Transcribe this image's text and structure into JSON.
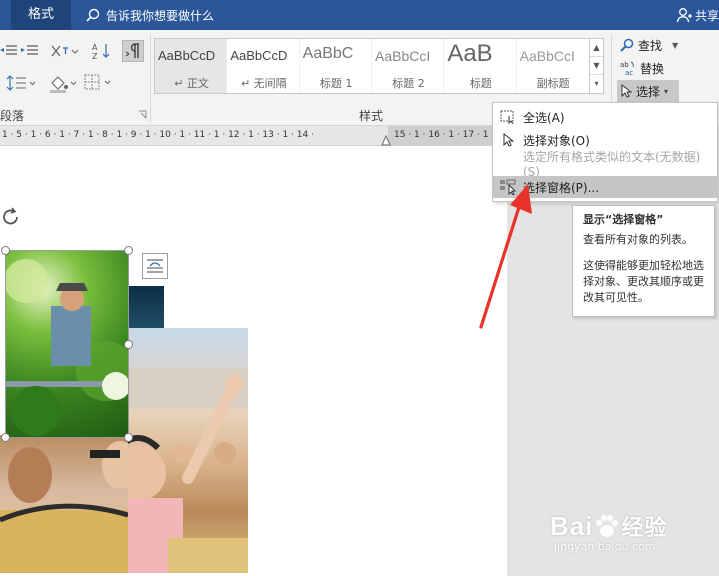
{
  "titlebar": {
    "active_tab": "格式",
    "tell_me": "告诉我你想要做什么",
    "share": "共享"
  },
  "ribbon": {
    "paragraph_group_label": "段落",
    "styles_group_label": "样式",
    "styles": [
      {
        "preview": "AaBbCcD",
        "name": "↵ 正文",
        "selected": true
      },
      {
        "preview": "AaBbCcD",
        "name": "↵ 无间隔",
        "selected": false
      },
      {
        "preview": "AaBbC",
        "name": "标题 1",
        "selected": false
      },
      {
        "preview": "AaBbCcI",
        "name": "标题 2",
        "selected": false
      },
      {
        "preview": "AaB",
        "name": "标题",
        "selected": false
      },
      {
        "preview": "AaBbCcI",
        "name": "副标题",
        "selected": false
      }
    ],
    "editing": {
      "find": "查找",
      "replace": "替换",
      "select": "选择"
    }
  },
  "ruler": {
    "labels": "1 · 5 · 1 · 6 · 1 · 7 · 1 · 8 · 1 · 9 · 1 · 10 · 1 · 11 · 1 · 12 · 1 · 13 · 1 · 14 ·",
    "labels_dark": "15 · 1 · 16 · 1 · 17 · 1"
  },
  "select_menu": {
    "items": [
      {
        "label": "全选(A)",
        "state": "normal"
      },
      {
        "label": "选择对象(O)",
        "state": "normal"
      },
      {
        "label": "选定所有格式类似的文本(无数据)(S)",
        "state": "disabled"
      },
      {
        "label": "选择窗格(P)...",
        "state": "hover"
      }
    ]
  },
  "tooltip": {
    "title": "显示“选择窗格”",
    "line1": "查看所有对象的列表。",
    "line2": "这使得能够更加轻松地选择对象、更改其顺序或更改其可见性。"
  },
  "watermark": {
    "brand": "Bai",
    "brand2": "经验",
    "url": "jingyan.baidu.com"
  },
  "colors": {
    "titlebar": "#2b579a",
    "annotation_arrow": "#e8322a"
  }
}
